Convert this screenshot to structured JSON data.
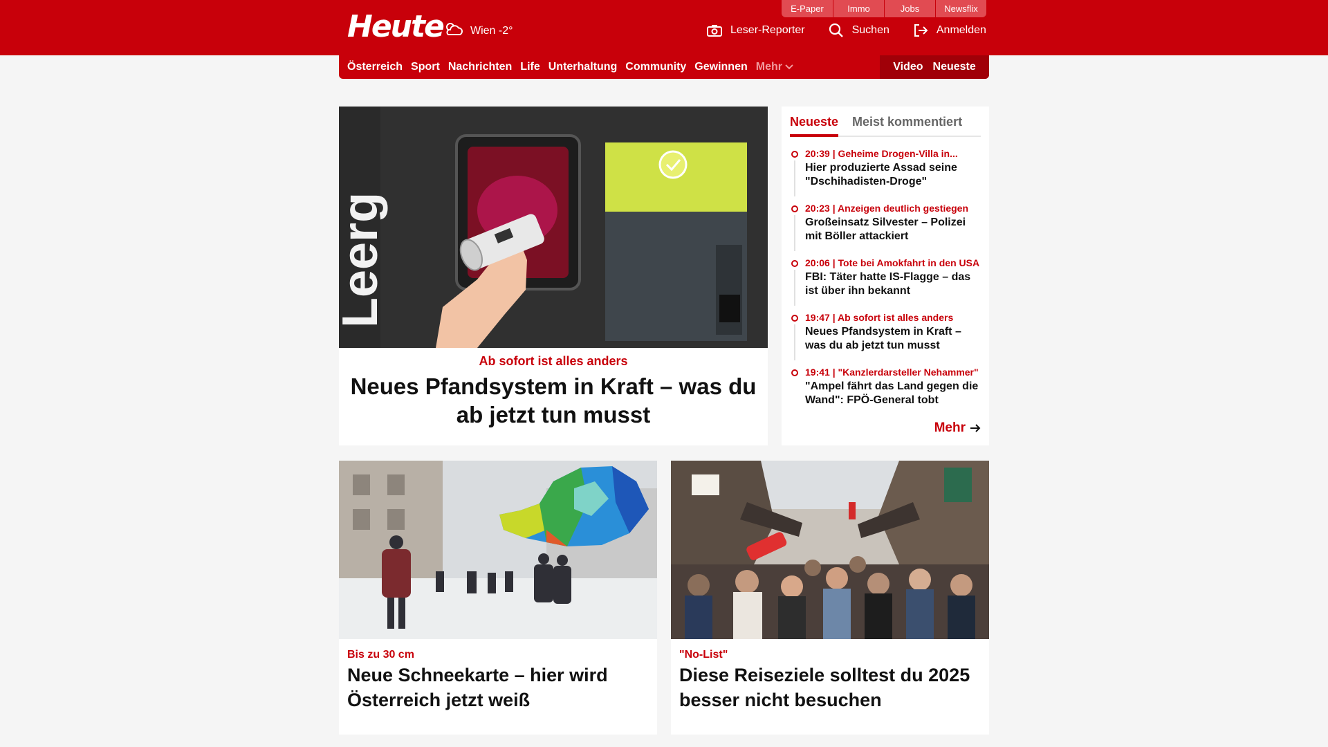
{
  "header": {
    "logo": "Heute",
    "weather": "Wien -2°",
    "top_links": [
      "E-Paper",
      "Immo",
      "Jobs",
      "Newsflix"
    ],
    "actions": {
      "reporter": "Leser-Reporter",
      "search": "Suchen",
      "login": "Anmelden"
    }
  },
  "nav": {
    "items": [
      "Österreich",
      "Sport",
      "Nachrichten",
      "Life",
      "Unterhaltung",
      "Community",
      "Gewinnen"
    ],
    "more": "Mehr",
    "video": "Video",
    "latest": "Neueste"
  },
  "hero": {
    "kicker": "Ab sofort ist alles anders",
    "title": "Neues Pfandsystem in Kraft – was du ab jetzt tun musst",
    "image_text": "Leerg"
  },
  "sidebar": {
    "tabs": [
      "Neueste",
      "Meist kommentiert"
    ],
    "items": [
      {
        "meta": "20:39 | Geheime Drogen-Villa in...",
        "head": "Hier produzierte Assad seine \"Dschihadisten-Droge\""
      },
      {
        "meta": "20:23 | Anzeigen deutlich gestiegen",
        "head": "Großeinsatz Silvester – Polizei mit Böller attackiert"
      },
      {
        "meta": "20:06 | Tote bei Amokfahrt in den USA",
        "head": "FBI: Täter hatte IS-Flagge – das ist über ihn bekannt"
      },
      {
        "meta": "19:47 | Ab sofort ist alles anders",
        "head": "Neues Pfandsystem in Kraft – was du ab jetzt tun musst"
      },
      {
        "meta": "19:41 | \"Kanzlerdarsteller Nehammer\"",
        "head": "\"Ampel fährt das Land gegen die Wand\": FPÖ-General tobt"
      }
    ],
    "more": "Mehr"
  },
  "cards": [
    {
      "kicker": "Bis zu 30 cm",
      "title": "Neue Schneekarte – hier wird Österreich jetzt weiß"
    },
    {
      "kicker": "\"No-List\"",
      "title": "Diese Reiseziele solltest du 2025 besser nicht besuchen"
    }
  ],
  "colors": {
    "brand": "#c8000a",
    "background": "#f5f5f5"
  }
}
